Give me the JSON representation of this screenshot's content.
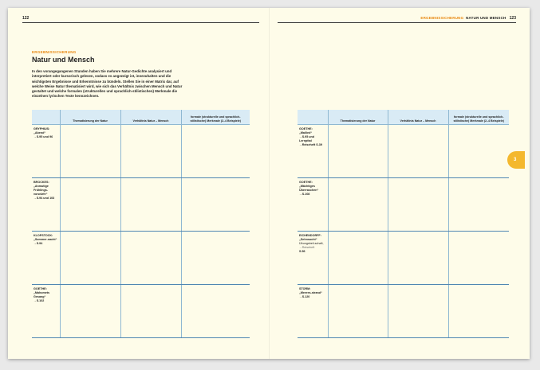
{
  "header_left": {
    "page_number": "122"
  },
  "header_right": {
    "section": "ERGEBNISSICHERUNG",
    "chapter": "NATUR UND MENSCH",
    "page_number": "123"
  },
  "kicker": "ERGEBNISSICHERUNG",
  "title": "Natur und Mensch",
  "intro": "In den vorangegangenen Stunden haben Sie mehrere Natur-Gedichte analysiert und interpretiert oder kursorisch gelesen, sodass es angezeigt ist, innezuhalten und die wichtigsten Ergebnisse und Erkenntnisse zu bündeln. Stellen Sie in einer Matrix dar, auf welche Weise Natur thematisiert wird, wie sich das Verhältnis zwischen Mensch und Natur gestaltet und welche formalen (strukturellen und sprachlich-stilistischen) Merkmale die einzelnen lyrischen Texte kennzeichnen.",
  "columns": [
    "",
    "Thematisierung der Natur",
    "Verhältnis Natur – Mensch",
    "formale (strukturelle und sprachlich-stilistische) Merkmale (2–4 Beispiele)"
  ],
  "left_rows": [
    {
      "author": "GRYPHIUS:",
      "work": "„Abend“",
      "extra": "",
      "hint": "",
      "ref": "→S.95 und 96"
    },
    {
      "author": "BROCKES:",
      "work": "„Anmutige Frühlings-vorwürfe“",
      "extra": "",
      "hint": "",
      "ref": "→S.94 und 103"
    },
    {
      "author": "KLOPSTOCK:",
      "work": "„Sommer-nacht“",
      "extra": "",
      "hint": "",
      "ref": "→S.94"
    },
    {
      "author": "GOETHE:",
      "work": "„Mahomets Gesang“",
      "extra": "",
      "hint": "",
      "ref": "→S.102"
    }
  ],
  "right_rows": [
    {
      "author": "GOETHE:",
      "work": "„Mailied“",
      "extra": "",
      "hint": "",
      "ref": "→S.95 und Lernpfad →Reiseheft S.39"
    },
    {
      "author": "GOETHE:",
      "work": "„Mächtiges Überraschen“",
      "extra": "",
      "hint": "",
      "ref": "→S.108"
    },
    {
      "author": "EICHENDORFF:",
      "work": "„Sehnsucht“",
      "extra": "Übungsbeil-schaft,",
      "hint": "→Reiseheft",
      "ref": "S.56"
    },
    {
      "author": "STORM:",
      "work": "„Meeres-strand“",
      "extra": "",
      "hint": "",
      "ref": "→S.120"
    }
  ],
  "chapter_badge": "3",
  "colors": {
    "accent": "#e8870f",
    "table_header": "#d9ebf5",
    "rule": "#4f86b2",
    "badge": "#f4b82e",
    "paper": "#fefce9"
  }
}
